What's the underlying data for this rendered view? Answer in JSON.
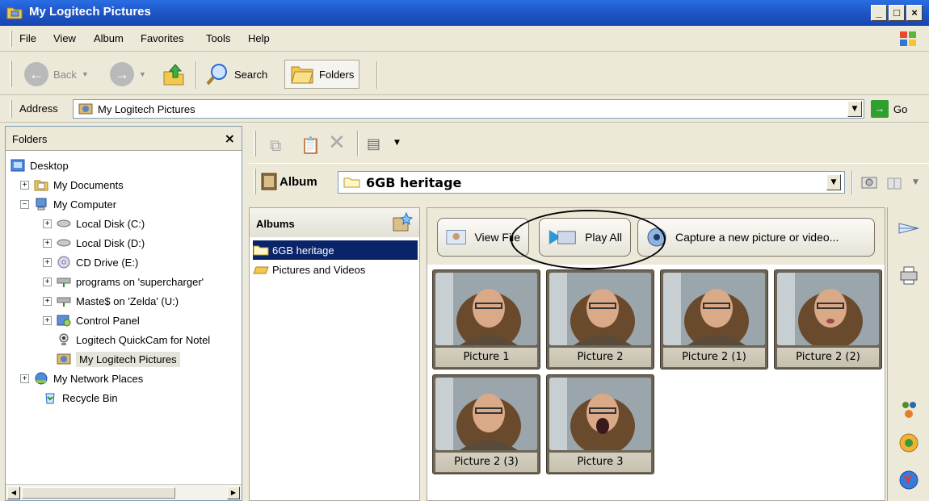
{
  "window": {
    "title": "My Logitech Pictures"
  },
  "menu": [
    "File",
    "View",
    "Album",
    "Favorites",
    "Tools",
    "Help"
  ],
  "toolbar": {
    "back": "Back",
    "search": "Search",
    "folders": "Folders"
  },
  "address": {
    "label": "Address",
    "value": "My Logitech Pictures",
    "go": "Go"
  },
  "folders_pane": {
    "title": "Folders",
    "close": "×",
    "items": [
      "Desktop",
      "My Documents",
      "My Computer",
      "Local Disk (C:)",
      "Local Disk (D:)",
      "CD Drive (E:)",
      "programs on 'supercharger'",
      "Maste$ on 'Zelda' (U:)",
      "Control Panel",
      "Logitech QuickCam for Notel",
      "My Logitech Pictures",
      "My Network Places",
      "Recycle Bin"
    ]
  },
  "album_bar": {
    "label": "Album",
    "value": "6GB heritage"
  },
  "albums_pane": {
    "title": "Albums",
    "items": [
      "6GB heritage",
      "Pictures and Videos"
    ]
  },
  "actions": {
    "view_file": "View File",
    "play_all": "Play All",
    "capture": "Capture a new picture or video..."
  },
  "thumbnails": [
    "Picture 1",
    "Picture 2",
    "Picture 2 (1)",
    "Picture 2 (2)",
    "Picture 2 (3)",
    "Picture 3"
  ]
}
